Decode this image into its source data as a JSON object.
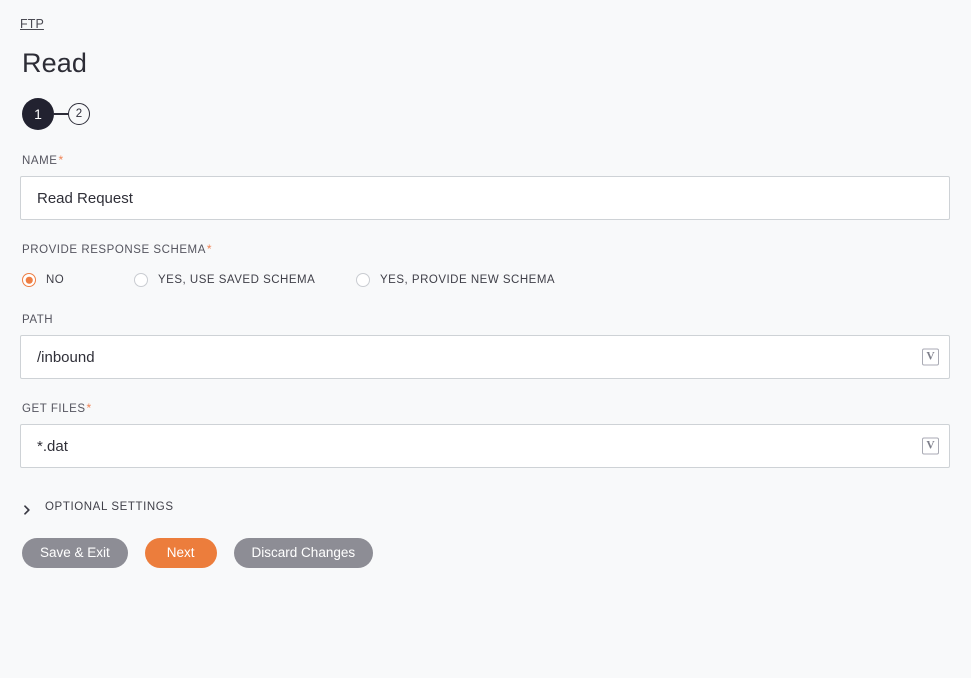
{
  "breadcrumb": {
    "label": "FTP"
  },
  "header": {
    "title": "Read"
  },
  "stepper": {
    "steps": [
      {
        "number": "1",
        "state": "active"
      },
      {
        "number": "2",
        "state": "inactive"
      }
    ]
  },
  "form": {
    "name": {
      "label": "NAME",
      "required": "*",
      "value": "Read Request",
      "placeholder": ""
    },
    "provide_response_schema": {
      "label": "PROVIDE RESPONSE SCHEMA",
      "required": "*",
      "options": [
        {
          "label": "NO",
          "selected": true
        },
        {
          "label": "YES, USE SAVED SCHEMA",
          "selected": false
        },
        {
          "label": "YES, PROVIDE NEW SCHEMA",
          "selected": false
        }
      ]
    },
    "path": {
      "label": "PATH",
      "required": "",
      "value": "/inbound",
      "placeholder": "",
      "variable_button": "V"
    },
    "get_files": {
      "label": "GET FILES",
      "required": "*",
      "value": "*.dat",
      "placeholder": "",
      "variable_button": "V"
    }
  },
  "optional_settings": {
    "label": "OPTIONAL SETTINGS",
    "expanded": false
  },
  "actions": {
    "save_exit_label": "Save & Exit",
    "next_label": "Next",
    "discard_label": "Discard Changes"
  },
  "colors": {
    "background": "#f8f9fa",
    "accent_orange": "#ec7d3c",
    "radio_orange": "#ee7e43",
    "required_asterisk": "#ef8354",
    "button_gray": "#8d8d95",
    "step_active": "#222230",
    "input_border": "#ced2d6",
    "text_primary": "#2b2b33"
  }
}
